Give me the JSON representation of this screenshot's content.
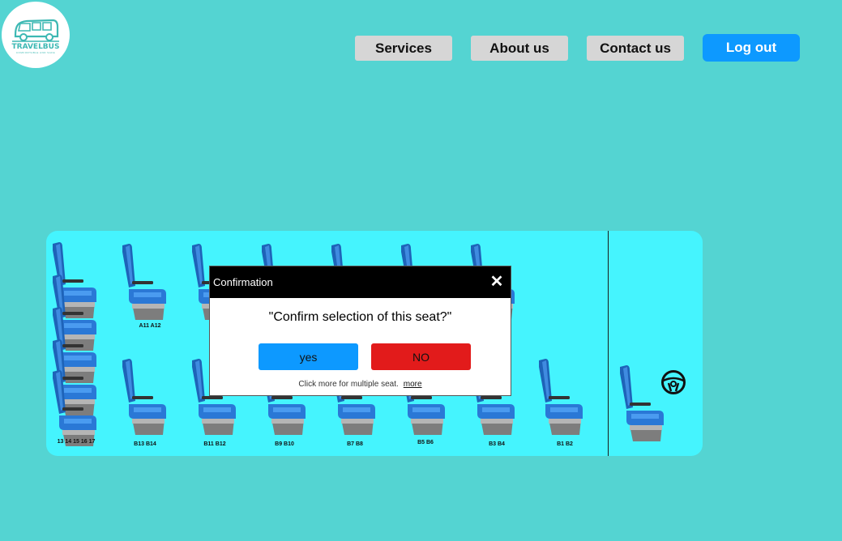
{
  "brand": {
    "name": "TRAVELBUS",
    "tagline": "COMFORTABLE AND SAFE",
    "color": "#3cb8b3"
  },
  "nav": {
    "services": "Services",
    "about": "About us",
    "contact": "Contact us",
    "logout": "Log out"
  },
  "seat_labels": {
    "a11_a12": "A11 A12",
    "col13_17": "13 14 15 16 17",
    "b13_b14": "B13 B14",
    "b11_b12": "B11 B12",
    "b9_b10": "B9 B10",
    "b7_b8": "B7 B8",
    "b5_b6": "B5 B6",
    "b3_b4": "B3 B4",
    "b1_b2": "B1 B2"
  },
  "dialog": {
    "title": "Confirmation",
    "question": "\"Confirm selection of this seat?\"",
    "yes": "yes",
    "no": "NO",
    "hint": "Click more for multiple seat.",
    "more": "more"
  },
  "colors": {
    "background": "#54d4d2",
    "bus_floor": "#45f4fe",
    "primary": "#0d99ff",
    "danger": "#e21b1b",
    "nav_grey": "#d6d6d6"
  },
  "icons": {
    "logo": "bus-icon",
    "close": "close-icon",
    "steering": "steering-wheel-icon",
    "seat": "seat-icon"
  }
}
